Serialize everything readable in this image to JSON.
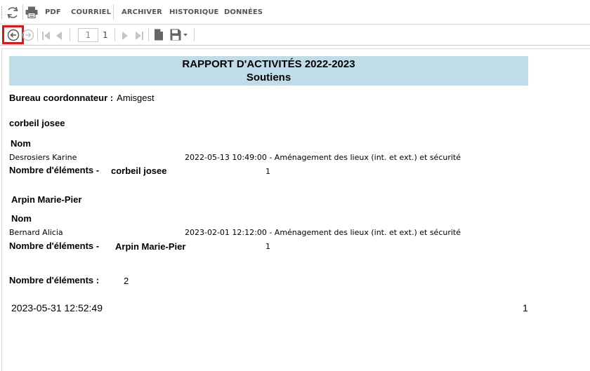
{
  "toolbar": {
    "refresh_icon": "refresh-icon",
    "print_icon": "printer-icon",
    "pdf_label": "PDF",
    "email_label": "COURRIEL",
    "archive_label": "ARCHIVER",
    "history_label": "HISTORIQUE",
    "data_label": "DONNÉES"
  },
  "nav": {
    "current_page": "1",
    "total_pages": "1",
    "back_icon": "back-circle-icon",
    "forward_icon": "forward-circle-icon",
    "first_icon": "first-page-icon",
    "prev_icon": "previous-page-icon",
    "next_icon": "next-page-icon",
    "last_icon": "last-page-icon",
    "page_icon": "page-icon",
    "save_icon": "save-icon",
    "highlight_color": "#e0151c"
  },
  "report": {
    "title": "RAPPORT D'ACTIVITÉS 2022-2023",
    "subtitle": "Soutiens",
    "banner_color": "#bfdde8",
    "bureau_label": "Bureau coordonnateur :",
    "bureau_value": "Amisgest",
    "groups": [
      {
        "header": "corbeil josee",
        "col_label": "Nom",
        "row_name": "Desrosiers Karine",
        "row_detail": "2022-05-13 10:49:00 - Aménagement des lieux (int. et ext.) et sécurité",
        "count_label": "Nombre d'éléments -",
        "count_name": "corbeil josee",
        "count_value": "1"
      },
      {
        "header": "Arpin Marie-Pier",
        "col_label": "Nom",
        "row_name": "Bernard Alicia",
        "row_detail": "2023-02-01 12:12:00 - Aménagement des lieux (int. et ext.) et sécurité",
        "count_label": "Nombre d'éléments -",
        "count_name": "Arpin Marie-Pier",
        "count_value": "1"
      }
    ],
    "total_label": "Nombre d'éléments :",
    "total_value": "2",
    "footer_date": "2023-05-31 12:52:49",
    "footer_page": "1"
  }
}
